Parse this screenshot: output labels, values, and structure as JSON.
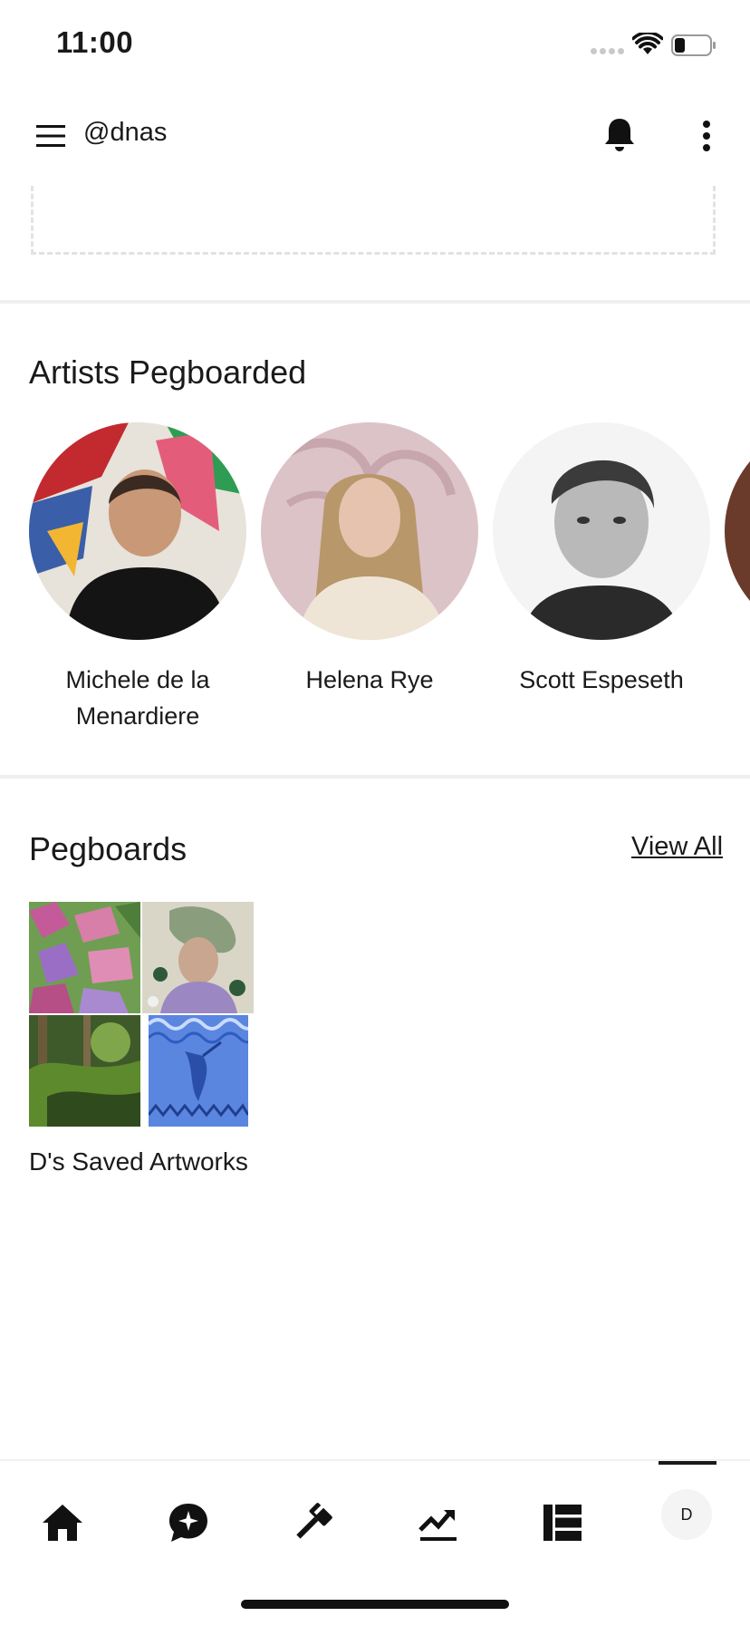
{
  "status_bar": {
    "time": "11:00"
  },
  "header": {
    "handle": "@dnas"
  },
  "artists_section": {
    "title": "Artists Pegboarded",
    "artists": [
      {
        "name": "Michele de la Menardiere"
      },
      {
        "name": "Helena Rye"
      },
      {
        "name": "Scott Espeseth"
      }
    ]
  },
  "pegboards_section": {
    "title": "Pegboards",
    "view_all_label": "View All",
    "boards": [
      {
        "title": "D's Saved Artworks"
      }
    ]
  },
  "bottom_nav": {
    "items": [
      {
        "icon": "home-icon"
      },
      {
        "icon": "chat-sparkle-icon"
      },
      {
        "icon": "auction-gavel-icon"
      },
      {
        "icon": "trending-up-icon"
      },
      {
        "icon": "list-icon"
      }
    ],
    "profile_initial": "D"
  },
  "colors": {
    "text": "#1a1a1a",
    "divider": "#efefef",
    "dashed_border": "#e2e2e2"
  }
}
